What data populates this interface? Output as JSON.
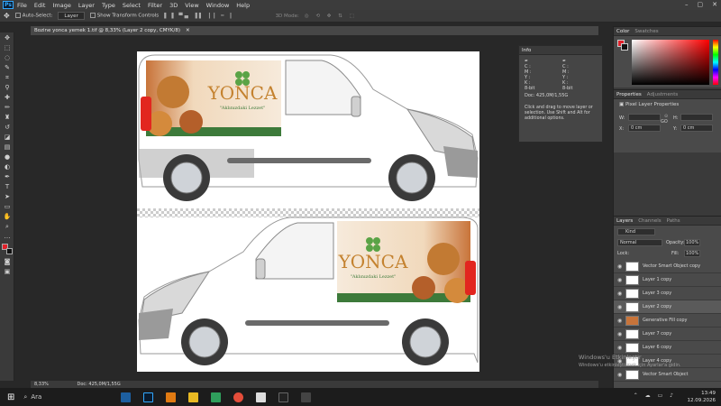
{
  "app": {
    "logo": "Ps",
    "menu": [
      "File",
      "Edit",
      "Image",
      "Layer",
      "Type",
      "Select",
      "Filter",
      "3D",
      "View",
      "Window",
      "Help"
    ]
  },
  "options": {
    "auto_select": "Auto-Select:",
    "auto_select_target": "Layer",
    "show_transform": "Show Transform Controls",
    "mode_3d": "3D Mode:"
  },
  "document": {
    "tab_title": "Bozine yonca yemek 1.tif @ 8,33% (Layer 2 copy, CMYK/8)",
    "zoom": "8,33%",
    "doc_size": "Doc: 425,0M/1,55G"
  },
  "artwork": {
    "brand": "YONCA",
    "slogan": "\"Aklınızdaki Lezzet\""
  },
  "info_panel": {
    "title": "Info",
    "c_label": "C",
    "m_label": "M",
    "y_label": "Y",
    "k_label": "K",
    "x_label": "X",
    "y_coord_label": "Y",
    "bit_left": "8-bit",
    "bit_right": "8-bit",
    "doc": "Doc: 425,0M/1,55G",
    "hint": "Click and drag to move layer or selection. Use Shift and Alt for additional options."
  },
  "color_panel": {
    "tabs": [
      "Color",
      "Swatches"
    ]
  },
  "properties": {
    "tabs": [
      "Properties",
      "Adjustments"
    ],
    "title": "Pixel Layer Properties",
    "w_label": "W:",
    "h_label": "H:",
    "x_label": "X:",
    "y_label": "Y:",
    "x_val": "0 cm",
    "y_val": "0 cm",
    "go": "GO"
  },
  "layers_panel": {
    "tabs": [
      "Layers",
      "Channels",
      "Paths"
    ],
    "kind": "Kind",
    "blend": "Normal",
    "opacity_label": "Opacity:",
    "opacity": "100%",
    "lock_label": "Lock:",
    "fill_label": "Fill:",
    "fill": "100%",
    "layers": [
      "Vector Smart Object copy",
      "Layer 1 copy",
      "Layer 3 copy",
      "Layer 2 copy",
      "Generative Fill copy",
      "Layer 7 copy",
      "Layer 6 copy",
      "Layer 4 copy",
      "Vector Smart Object"
    ]
  },
  "windows_watermark": {
    "line1": "Windows'u Etkinleştir",
    "line2": "Windows'u etkinleştirmek için Ayarlar'a gidin."
  },
  "taskbar": {
    "search": "Ara",
    "time": "13:49",
    "date": "12.09.2026"
  }
}
